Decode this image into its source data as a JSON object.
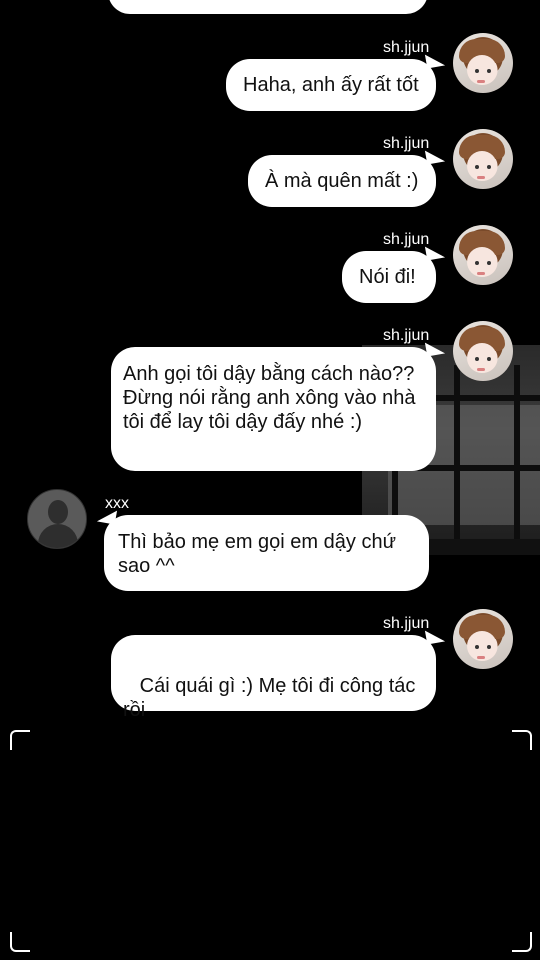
{
  "messages": [
    {
      "sender": "",
      "text": ""
    },
    {
      "sender": "sh.jjun",
      "text": "Haha, anh ấy rất tốt"
    },
    {
      "sender": "sh.jjun",
      "text": "À mà quên mất :)"
    },
    {
      "sender": "sh.jjun",
      "text": "Nói đi!"
    },
    {
      "sender": "sh.jjun",
      "text": "Anh gọi tôi dậy bằng cách nào?? Đừng nói rằng anh xông vào nhà tôi để lay tôi dậy đấy nhé :)"
    },
    {
      "sender": "xxx",
      "text": "Thì bảo mẹ em gọi em dậy chứ sao ^^"
    },
    {
      "sender": "sh.jjun",
      "text": " Cái quái gì :) Mẹ tôi đi công tác rồi"
    }
  ],
  "icons": {
    "user_avatar": "profile-photo-icon",
    "contact_avatar": "default-person-icon",
    "viewfinder": "corner-bracket-icon"
  }
}
